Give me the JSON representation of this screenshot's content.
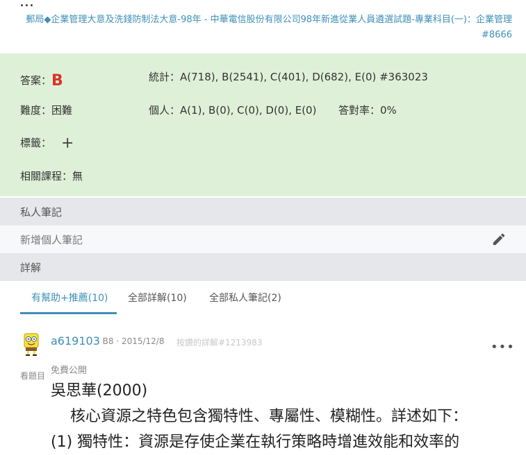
{
  "page": {
    "breadcrumb": {
      "category": "郵局◆企業管理大意及洗錢防制法大意",
      "year": "-98年",
      "separator": " - ",
      "exam_title": "中華電信股份有限公司98年新進從業人員遴選試題-專業科目(一)：企業管理#8666"
    }
  },
  "info": {
    "answer_label": "答案：",
    "answer_value": "B",
    "stats_label": "統計：",
    "stats_value": "A(718), B(2541), C(401), D(682), E(0) #363023",
    "difficulty_label": "難度：",
    "difficulty_value": "困難",
    "personal_label": "個人：",
    "personal_value": "A(1), B(0), C(0), D(0), E(0)",
    "accuracy_label": "答對率：",
    "accuracy_value": "0%",
    "tags_label": "標籤：",
    "tags_add": "+",
    "courses_label": "相關課程：",
    "courses_value": "無"
  },
  "notes": {
    "header": "私人筆記",
    "placeholder": "新增個人筆記",
    "edit_icon": "pencil-icon"
  },
  "explanation": {
    "header": "詳解",
    "tabs": [
      "有幫助+推薦(10)",
      "全部詳解(10)",
      "全部私人筆記(2)"
    ],
    "active_tab": 0
  },
  "post": {
    "avatar_icon": "spongebob-avatar-icon",
    "view_question": "看題目",
    "author": "a619103",
    "meta": " · B8 · 2015/12/8",
    "reply_link": "按讚的詳解#1213983",
    "more_icon": "•••",
    "visibility": "免費公開",
    "lines": [
      "吳思華(2000)",
      "核心資源之特色包含獨特性、專屬性、模糊性。詳述如下：",
      "(1) 獨特性：資源是存使企業在執行策略時增進效能和效率的"
    ]
  },
  "colors": {
    "accent": "#3d8fb6",
    "answer": "#d9342b",
    "info_bg": "#dff0d8",
    "bar_bg": "#e6e7ea"
  }
}
